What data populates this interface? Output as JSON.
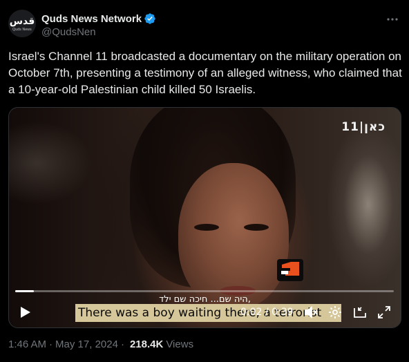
{
  "account": {
    "display_name": "Quds News Network",
    "handle": "@QudsNen",
    "avatar_logo_text": "قدس",
    "avatar_logo_subtext": "Quds News"
  },
  "tweet": {
    "text": "Israel's Channel 11 broadcasted a documentary on the military operation on October 7th, presenting a testimony of an alleged witness, who claimed that a 10-year-old Palestinian child killed 50 Israelis."
  },
  "video": {
    "channel_logo": "11|כאן",
    "hebrew_subtitle": "היה שם... חיכה שם ילד,",
    "english_subtitle": "There was a boy waiting there, a terrorist",
    "current_time": "0:02",
    "time_separator": " / ",
    "duration": "0:39",
    "progress_fraction": 0.05,
    "muted": true
  },
  "meta": {
    "time": "1:46 AM",
    "date": "May 17, 2024",
    "separator": "·",
    "views_count": "218.4K",
    "views_label": "Views"
  },
  "colors": {
    "background": "#000000",
    "text": "#e7e9ea",
    "muted_text": "#71767b",
    "verified_blue": "#1d9bf0",
    "subtitle_box": "#d6c79b"
  },
  "icons": {
    "verified": "verified-badge-icon",
    "more": "more-options-icon",
    "play": "play-icon",
    "mute": "volume-muted-icon",
    "settings": "settings-gear-icon",
    "pip": "picture-in-picture-icon",
    "fullscreen": "fullscreen-icon"
  }
}
